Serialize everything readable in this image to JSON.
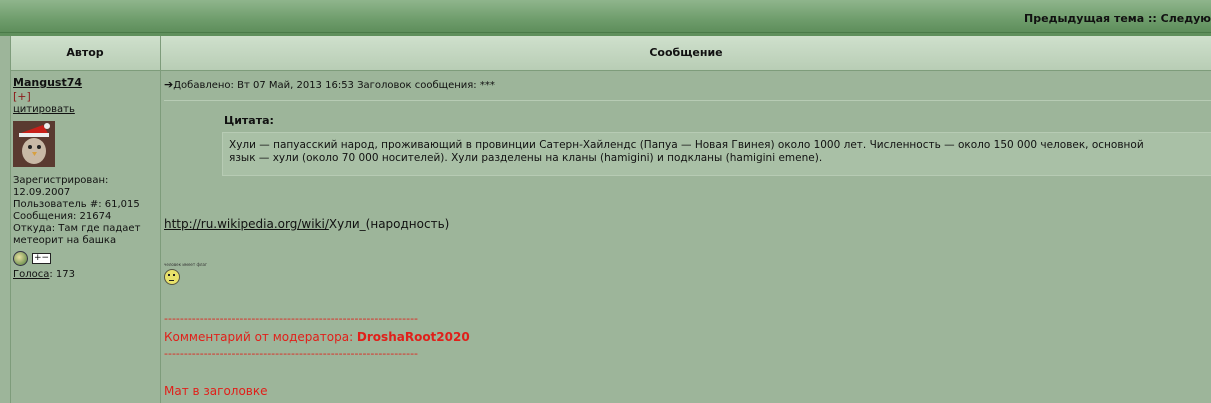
{
  "nav": {
    "prev_next": "Предыдущая тема :: Следую"
  },
  "header": {
    "author": "Автор",
    "message": "Сообщение"
  },
  "author": {
    "name": "Mangust74",
    "plus": "[+]",
    "quote_link": "цитировать",
    "registered_label": "Зарегистрирован:",
    "registered_date": "12.09.2007",
    "user_number": "Пользователь #: 61,015",
    "posts": "Сообщения: 21674",
    "location_line1": "Откуда: Там где падает",
    "location_line2": "метеорит на башка",
    "votes_label": "Голоса",
    "votes_value": ": 173"
  },
  "post": {
    "header": "Добавлено: Вт 07 Май, 2013 16:53    Заголовок сообщения: ***",
    "quote_label": "Цитата:",
    "quote_text": "Хули — папуасский народ, проживающий в провинции Сатерн-Хайлендс (Папуа — Новая Гвинея) около 1000 лет. Численность — около 150 000 человек, основной\nязык — хули (около 70 000 носителей). Хули разделены на кланы (hamigini) и подкланы (hamigini emene).",
    "wiki_link": "http://ru.wikipedia.org/wiki/",
    "wiki_suffix": "Хули_(народность)",
    "tiny_text": "человек имеет флаг",
    "mod_line": "----------------------------------------------------------------",
    "mod_comment": "Комментарий от модератора: ",
    "mod_name": "DroshaRoot2020",
    "mod_line2": "----------------------------------------------------------------",
    "mod_reason": "Мат в заголовке"
  }
}
